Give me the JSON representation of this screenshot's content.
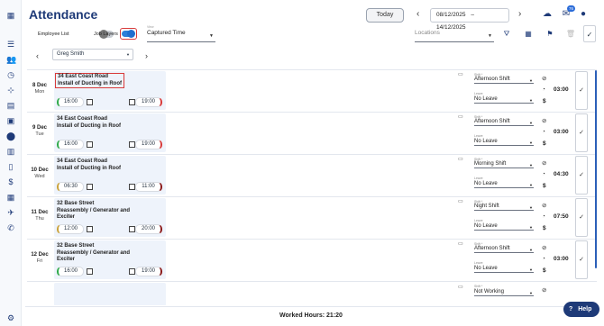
{
  "header": {
    "title": "Attendance",
    "today_label": "Today",
    "date_from": "08/12/2025",
    "date_sep": "–",
    "date_to": "14/12/2025",
    "notification_count": "76"
  },
  "filters": {
    "employee_list_label": "Employee List",
    "job_layers_label": "Job Layers",
    "view_label": "View",
    "view_value": "Captured Time",
    "locations_placeholder": "Locations"
  },
  "employee": {
    "selected": "Greg Smith"
  },
  "field_labels": {
    "shift": "Shift *",
    "leave": "Leave"
  },
  "rows": [
    {
      "date": "8 Dec",
      "weekday": "Mon",
      "job_line1": "34 East Coast Road",
      "job_line2": "Install of Ducting in Roof",
      "job_line3": "",
      "start": "16:00",
      "end": "19:00",
      "shift": "Afternoon Shift",
      "leave": "No Leave",
      "hours": "03:00",
      "highlight": true
    },
    {
      "date": "9 Dec",
      "weekday": "Tue",
      "job_line1": "34 East Coast Road",
      "job_line2": "Install of Ducting in Roof",
      "job_line3": "",
      "start": "16:00",
      "end": "19:00",
      "shift": "Afternoon Shift",
      "leave": "No Leave",
      "hours": "03:00"
    },
    {
      "date": "10 Dec",
      "weekday": "Wed",
      "job_line1": "34 East Coast Road",
      "job_line2": "Install of Ducting in Roof",
      "job_line3": "",
      "start": "06:30",
      "end": "11:00",
      "shift": "Morning Shift",
      "leave": "No Leave",
      "hours": "04:30"
    },
    {
      "date": "11 Dec",
      "weekday": "Thu",
      "job_line1": "32 Base Street",
      "job_line2": "Reassembly / Generator and",
      "job_line3": "Exciter",
      "start": "12:00",
      "end": "20:00",
      "shift": "Night Shift",
      "leave": "No Leave",
      "hours": "07:50"
    },
    {
      "date": "12 Dec",
      "weekday": "Fri",
      "job_line1": "32 Base Street",
      "job_line2": "Reassembly / Generator and",
      "job_line3": "Exciter",
      "start": "16:00",
      "end": "19:00",
      "shift": "Afternoon Shift",
      "leave": "No Leave",
      "hours": "03:00"
    }
  ],
  "partial_row": {
    "shift": "Not Working"
  },
  "footer": {
    "worked_hours": "Worked Hours: 21:20",
    "help_label": "Help"
  }
}
